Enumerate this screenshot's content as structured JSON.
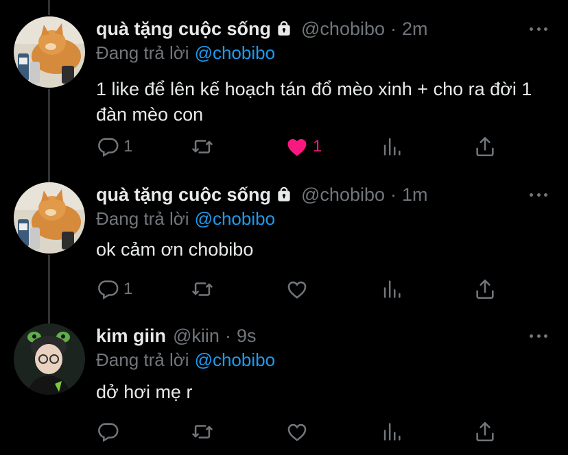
{
  "tweets": [
    {
      "display_name": "quà tặng cuộc sống",
      "handle": "@chobibo",
      "separator": "·",
      "time": "2m",
      "reply_label": "Đang trả lời",
      "reply_to": "@chobibo",
      "text": "1 like để lên kế hoạch tán đổ mèo xinh + cho ra đời 1 đàn mèo con",
      "reply_count": "1",
      "retweet_count": "",
      "like_count": "1",
      "liked": true
    },
    {
      "display_name": "quà tặng cuộc sống",
      "handle": "@chobibo",
      "separator": "·",
      "time": "1m",
      "reply_label": "Đang trả lời",
      "reply_to": "@chobibo",
      "text": "ok cảm ơn chobibo",
      "reply_count": "1",
      "retweet_count": "",
      "like_count": "",
      "liked": false
    },
    {
      "display_name": "kim giin",
      "handle": "@kiin",
      "separator": "·",
      "time": "9s",
      "reply_label": "Đang trả lời",
      "reply_to": "@chobibo",
      "text": "dở hơi mẹ r",
      "reply_count": "",
      "retweet_count": "",
      "like_count": "",
      "liked": false
    }
  ],
  "colors": {
    "background": "#000000",
    "text": "#e7e9ea",
    "muted": "#71767b",
    "link": "#1d9bf0",
    "like": "#f91880"
  }
}
